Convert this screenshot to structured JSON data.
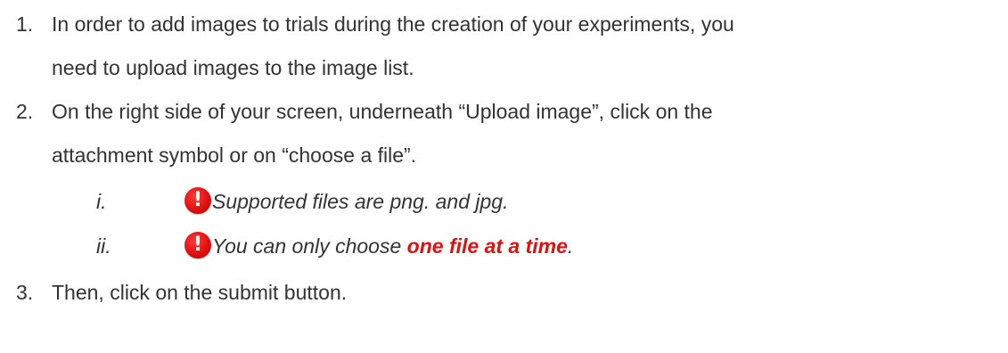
{
  "steps": [
    {
      "number": "1.",
      "lines": [
        "In order to add images to trials during the creation of your experiments, you",
        "need to upload images to the image list."
      ]
    },
    {
      "number": "2.",
      "lines": [
        "On the right side of your screen, underneath “Upload image”, click on the",
        "attachment symbol or on “choose a file”."
      ],
      "notes": [
        {
          "number": "i.",
          "icon": "exclamation-alert-icon",
          "text": "Supported files are png. and jpg."
        },
        {
          "number": "ii.",
          "icon": "exclamation-alert-icon",
          "text_before": "You can only choose ",
          "emphasis": "one file at a time",
          "text_after": "."
        }
      ]
    },
    {
      "number": "3.",
      "lines": [
        "Then, click on the submit button."
      ]
    }
  ],
  "colors": {
    "body_text": "#333333",
    "alert_red": "#e11010"
  }
}
